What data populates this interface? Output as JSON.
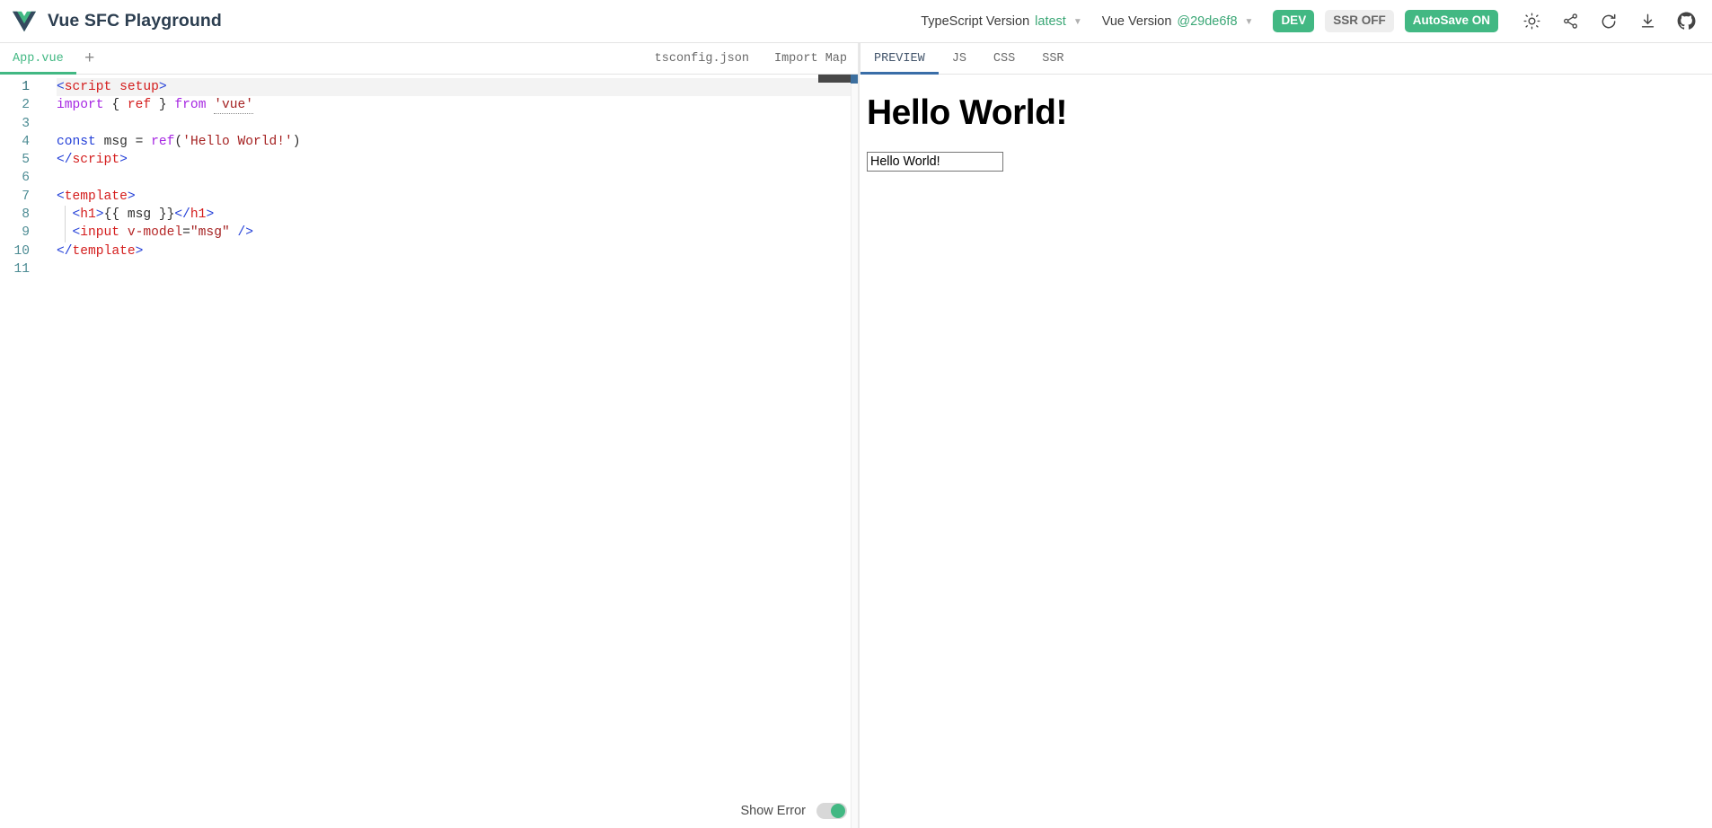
{
  "header": {
    "logo_icon": "vue-logo-icon",
    "title": "Vue SFC Playground",
    "ts_version_label": "TypeScript Version",
    "ts_version_value": "latest",
    "vue_version_label": "Vue Version",
    "vue_version_value": "@29de6f8",
    "caret_glyph": "▼",
    "dev_button": "DEV",
    "ssr_button": "SSR OFF",
    "autosave_button": "AutoSave ON",
    "icons": [
      {
        "name": "sun-icon",
        "title": "Toggle dark mode"
      },
      {
        "name": "share-icon",
        "title": "Share"
      },
      {
        "name": "reload-icon",
        "title": "Reload page"
      },
      {
        "name": "download-icon",
        "title": "Download"
      },
      {
        "name": "github-icon",
        "title": "View on GitHub"
      }
    ],
    "accent_green": "#42b883",
    "accent_blue": "#3a6ea8"
  },
  "filebar": {
    "tabs": [
      {
        "label": "App.vue",
        "active": true
      }
    ],
    "add_file_glyph": "+",
    "right_tabs": [
      {
        "label": "tsconfig.json",
        "active": false
      },
      {
        "label": "Import Map",
        "active": false
      }
    ]
  },
  "output_tabs": [
    {
      "label": "PREVIEW",
      "active": true
    },
    {
      "label": "JS",
      "active": false
    },
    {
      "label": "CSS",
      "active": false
    },
    {
      "label": "SSR",
      "active": false
    }
  ],
  "editor": {
    "line_numbers": [
      "1",
      "2",
      "3",
      "4",
      "5",
      "6",
      "7",
      "8",
      "9",
      "10",
      "11"
    ],
    "active_line": 1,
    "code_text": "<script setup>\nimport { ref } from 'vue'\n\nconst msg = ref('Hello World!')\n</script>\n\n<template>\n  <h1>{{ msg }}</h1>\n  <input v-model=\"msg\" />\n</template>\n",
    "lines": [
      {
        "n": "1",
        "tokens": [
          {
            "t": "<",
            "c": "t-tagbr"
          },
          {
            "t": "script",
            "c": "t-tag"
          },
          {
            "t": " ",
            "c": "t-punc"
          },
          {
            "t": "setup",
            "c": "t-name"
          },
          {
            "t": ">",
            "c": "t-tagbr"
          }
        ]
      },
      {
        "n": "2",
        "tokens": [
          {
            "t": "import",
            "c": "t-imp"
          },
          {
            "t": " ",
            "c": "t-punc"
          },
          {
            "t": "{",
            "c": "t-brace"
          },
          {
            "t": " ",
            "c": "t-punc"
          },
          {
            "t": "ref",
            "c": "t-name"
          },
          {
            "t": " ",
            "c": "t-punc"
          },
          {
            "t": "}",
            "c": "t-brace"
          },
          {
            "t": " ",
            "c": "t-punc"
          },
          {
            "t": "from",
            "c": "t-imp"
          },
          {
            "t": " ",
            "c": "t-punc"
          },
          {
            "t": "'vue'",
            "c": "t-str-u"
          }
        ]
      },
      {
        "n": "3",
        "tokens": []
      },
      {
        "n": "4",
        "tokens": [
          {
            "t": "const",
            "c": "t-kw"
          },
          {
            "t": " ",
            "c": "t-punc"
          },
          {
            "t": "msg",
            "c": "t-ident"
          },
          {
            "t": " ",
            "c": "t-punc"
          },
          {
            "t": "=",
            "c": "t-op"
          },
          {
            "t": " ",
            "c": "t-punc"
          },
          {
            "t": "ref",
            "c": "t-fn"
          },
          {
            "t": "(",
            "c": "t-punc"
          },
          {
            "t": "'Hello World!'",
            "c": "t-str"
          },
          {
            "t": ")",
            "c": "t-punc"
          }
        ]
      },
      {
        "n": "5",
        "tokens": [
          {
            "t": "<",
            "c": "t-tagbr"
          },
          {
            "t": "/",
            "c": "t-tagbr"
          },
          {
            "t": "script",
            "c": "t-tag"
          },
          {
            "t": ">",
            "c": "t-tagbr"
          }
        ]
      },
      {
        "n": "6",
        "tokens": []
      },
      {
        "n": "7",
        "tokens": [
          {
            "t": "<",
            "c": "t-tagbr"
          },
          {
            "t": "template",
            "c": "t-tag"
          },
          {
            "t": ">",
            "c": "t-tagbr"
          }
        ]
      },
      {
        "n": "8",
        "tokens": [
          {
            "t": "  ",
            "c": "t-punc"
          },
          {
            "t": "<",
            "c": "t-tagbr"
          },
          {
            "t": "h1",
            "c": "t-tag"
          },
          {
            "t": ">",
            "c": "t-tagbr"
          },
          {
            "t": "{{ msg }}",
            "c": "t-punc"
          },
          {
            "t": "<",
            "c": "t-tagbr"
          },
          {
            "t": "/",
            "c": "t-tagbr"
          },
          {
            "t": "h1",
            "c": "t-tag"
          },
          {
            "t": ">",
            "c": "t-tagbr"
          }
        ]
      },
      {
        "n": "9",
        "tokens": [
          {
            "t": "  ",
            "c": "t-punc"
          },
          {
            "t": "<",
            "c": "t-tagbr"
          },
          {
            "t": "input",
            "c": "t-tag"
          },
          {
            "t": " ",
            "c": "t-punc"
          },
          {
            "t": "v-model",
            "c": "t-attr"
          },
          {
            "t": "=",
            "c": "t-punc"
          },
          {
            "t": "\"msg\"",
            "c": "t-str"
          },
          {
            "t": " ",
            "c": "t-punc"
          },
          {
            "t": "/>",
            "c": "t-tagbr"
          }
        ]
      },
      {
        "n": "10",
        "tokens": [
          {
            "t": "<",
            "c": "t-tagbr"
          },
          {
            "t": "/",
            "c": "t-tagbr"
          },
          {
            "t": "template",
            "c": "t-tag"
          },
          {
            "t": ">",
            "c": "t-tagbr"
          }
        ]
      },
      {
        "n": "11",
        "tokens": []
      }
    ]
  },
  "status": {
    "show_error_label": "Show Error",
    "show_error_on": true
  },
  "preview": {
    "heading": "Hello World!",
    "input_value": "Hello World!",
    "input_placeholder": ""
  }
}
